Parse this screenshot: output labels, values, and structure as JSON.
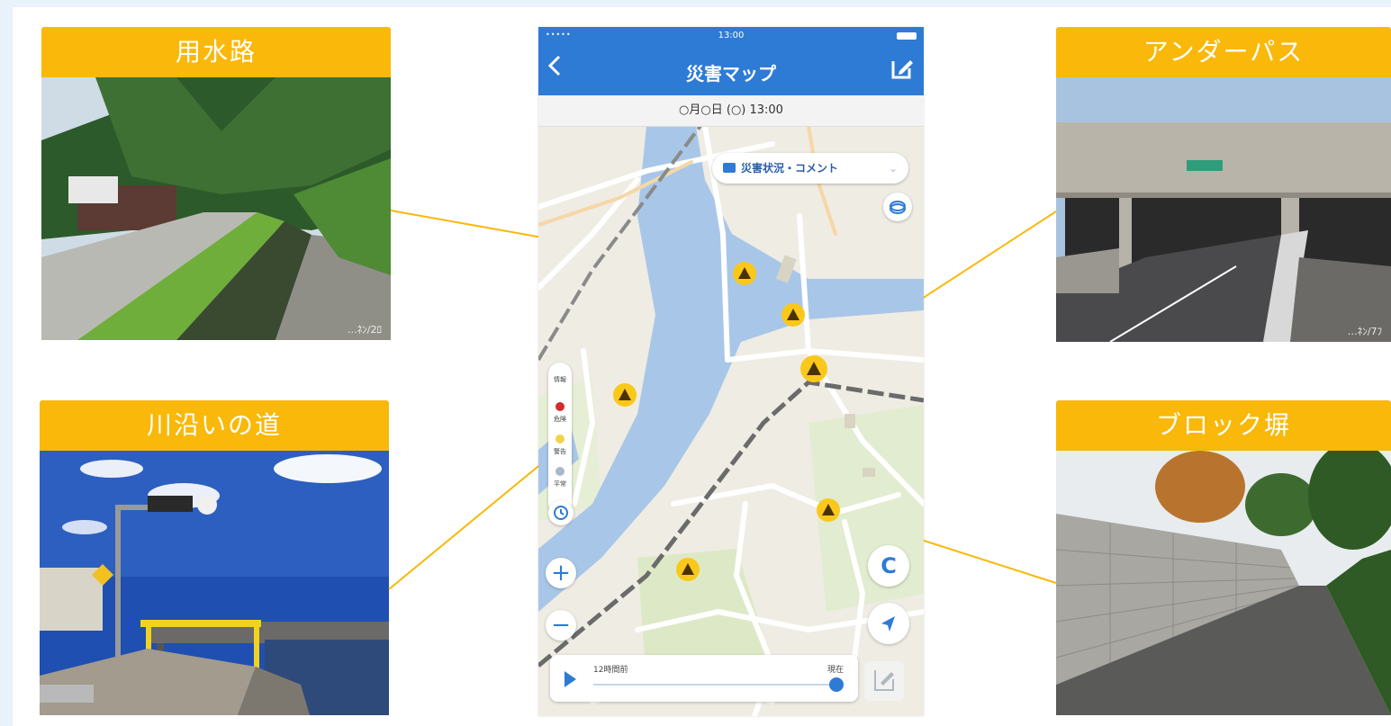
{
  "colors": {
    "accent_yellow": "#f9b80a",
    "app_blue": "#2e7bd6",
    "river_blue": "#a8c7e8",
    "map_land": "#efece4"
  },
  "cards": {
    "irrigation": {
      "title": "用水路",
      "photo_watermark": "…ﾈﾝ/2ﾛ"
    },
    "underpass": {
      "title": "アンダーパス",
      "photo_watermark": "…ﾈﾝ/7ﾌ"
    },
    "riverside": {
      "title": "川沿いの道"
    },
    "block_wall": {
      "title": "ブロック塀"
    }
  },
  "phone": {
    "status": {
      "signal": "•••••",
      "time": "13:00",
      "battery_icon": "battery-icon"
    },
    "nav": {
      "back_icon": "chevron-left-icon",
      "title": "災害マップ",
      "edit_icon": "edit-icon"
    },
    "date_text": "○月○日 (○) 13:00",
    "layer_selector": {
      "icon": "comment-icon",
      "label": "災害状況・コメント",
      "chevron": "⌄"
    },
    "legend": {
      "header": "情報",
      "items": [
        {
          "label": "危険",
          "color": "#d92a2a"
        },
        {
          "label": "警告",
          "color": "#f2d24a"
        },
        {
          "label": "平常",
          "color": "#a9b9cc"
        }
      ]
    },
    "zoom": {
      "in_label": "+",
      "out_label": "−"
    },
    "refresh_label": "C",
    "timeline": {
      "start_label": "12時間前",
      "end_label": "現在"
    },
    "report_icon": "report-icon"
  }
}
